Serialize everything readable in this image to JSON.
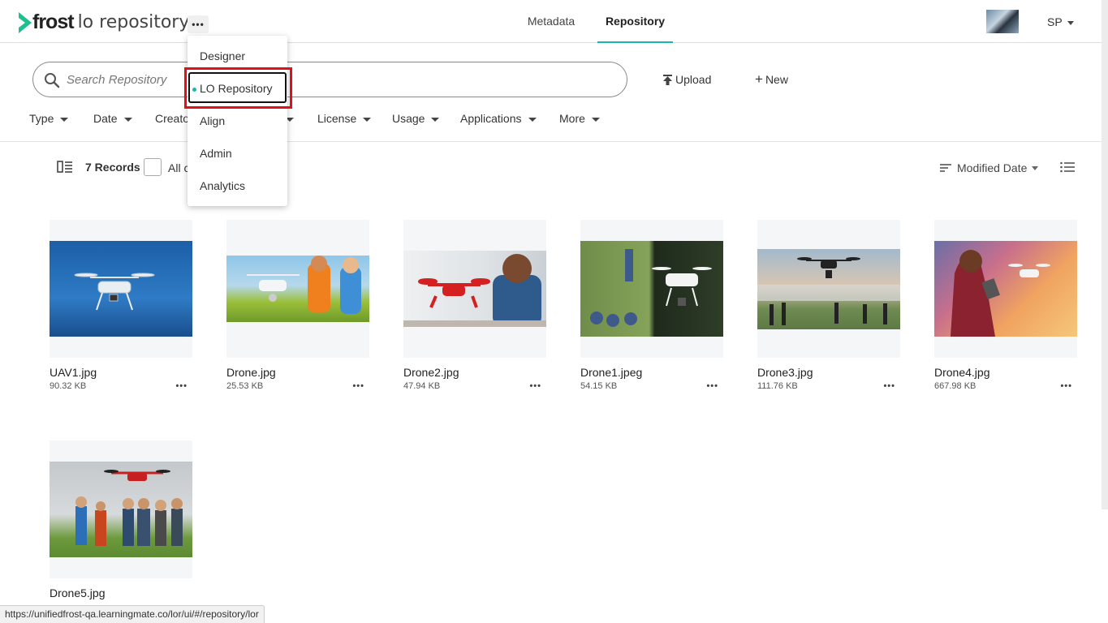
{
  "header": {
    "brand": "frost",
    "product": "lo repository",
    "more_label": "•••",
    "tabs": [
      {
        "label": "Metadata",
        "active": false
      },
      {
        "label": "Repository",
        "active": true
      }
    ],
    "user": "SP"
  },
  "app_menu": {
    "items": [
      {
        "label": "Designer"
      },
      {
        "label": "LO Repository",
        "selected": true
      },
      {
        "label": "Align"
      },
      {
        "label": "Admin"
      },
      {
        "label": "Analytics"
      }
    ]
  },
  "search": {
    "placeholder": "Search Repository"
  },
  "actions": {
    "upload": "Upload",
    "new": "New"
  },
  "filters": [
    "Type",
    "Date",
    "Creato",
    "License",
    "Usage",
    "Applications",
    "More"
  ],
  "toolbar": {
    "records": "7 Records",
    "select_all": "All c",
    "sort_label": "Modified Date"
  },
  "files": [
    {
      "name": "UAV1.jpg",
      "size": "90.32 KB"
    },
    {
      "name": "Drone.jpg",
      "size": "25.53 KB"
    },
    {
      "name": "Drone2.jpg",
      "size": "47.94 KB"
    },
    {
      "name": "Drone1.jpeg",
      "size": "54.15 KB"
    },
    {
      "name": "Drone3.jpg",
      "size": "111.76 KB"
    },
    {
      "name": "Drone4.jpg",
      "size": "667.98 KB"
    },
    {
      "name": "Drone5.jpg",
      "size": ""
    }
  ],
  "file_more": "•••",
  "status_url": "https://unifiedfrost-qa.learningmate.co/lor/ui/#/repository/lor",
  "colors": {
    "accent": "#19b7b0",
    "highlight": "#e0101b"
  }
}
